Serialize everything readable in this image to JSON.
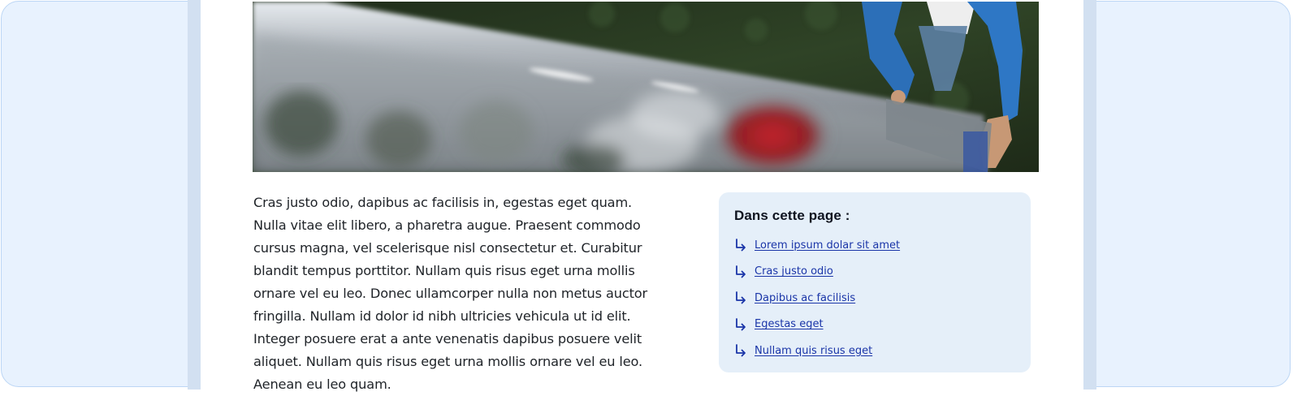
{
  "hero": {
    "alt_icon": "ladder-photo"
  },
  "article": {
    "paragraph": "Cras justo odio, dapibus ac facilisis in, egestas eget quam. Nulla vitae elit libero, a pharetra augue. Praesent commodo cursus magna, vel scelerisque nisl consectetur et. Curabitur blandit tempus porttitor. Nullam quis risus eget urna mollis ornare vel eu leo. Donec ullamcorper nulla non metus auctor fringilla. Nullam id dolor id nibh ultricies vehicula ut id elit. Integer posuere erat a ante venenatis dapibus posuere velit aliquet. Nullam quis risus eget urna mollis ornare vel eu leo. Aenean eu leo quam."
  },
  "toc": {
    "title": "Dans cette page :",
    "items": [
      {
        "label": "Lorem ipsum dolar sit amet",
        "icon": "arrow-return-icon"
      },
      {
        "label": "Cras justo odio",
        "icon": "arrow-return-icon"
      },
      {
        "label": "Dapibus ac facilisis",
        "icon": "arrow-return-icon"
      },
      {
        "label": "Egestas eget",
        "icon": "arrow-return-icon"
      },
      {
        "label": "Nullam quis risus eget",
        "icon": "arrow-return-icon"
      }
    ]
  },
  "colors": {
    "outer_background": "#e8f2fe",
    "gutter": "#d2e0f1",
    "toc_background": "#e5eff9",
    "link": "#1a35a8"
  }
}
